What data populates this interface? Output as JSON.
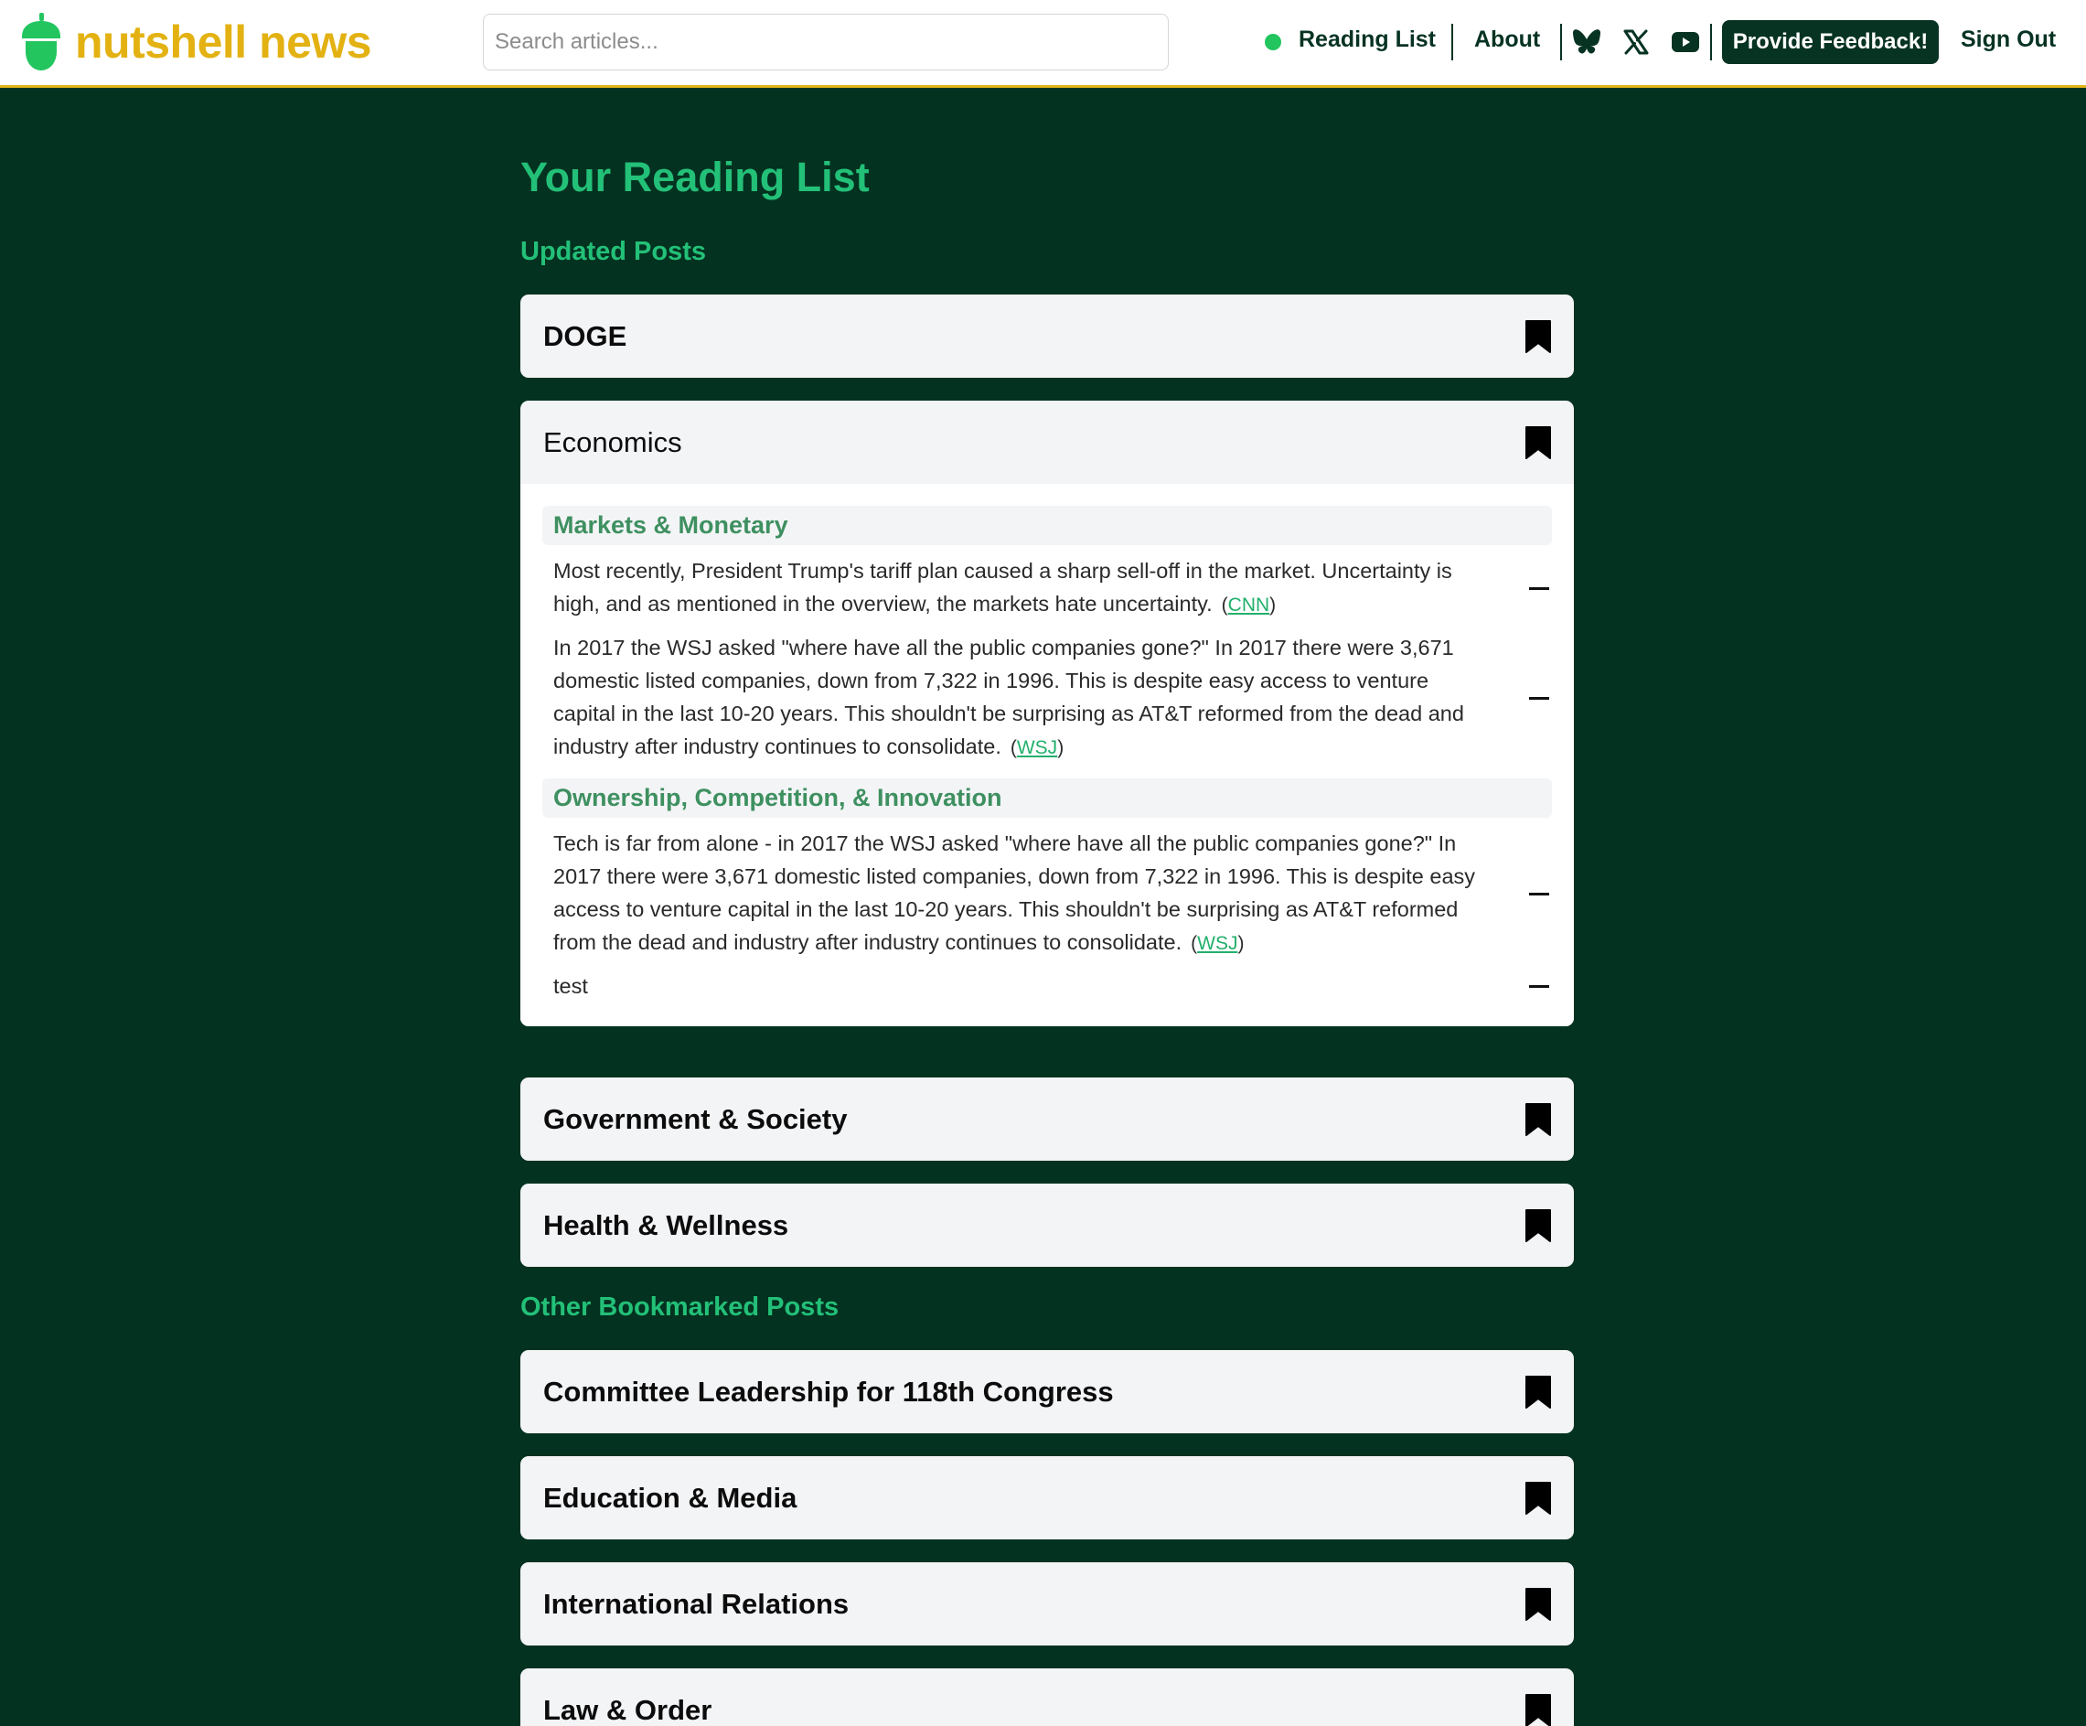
{
  "header": {
    "brand": "nutshell news",
    "search_placeholder": "Search articles...",
    "nav": {
      "reading_list": "Reading List",
      "about": "About",
      "feedback": "Provide Feedback!",
      "sign_out": "Sign Out"
    },
    "social_icons": [
      "bluesky-icon",
      "x-icon",
      "youtube-icon"
    ],
    "status_color": "#22c55e"
  },
  "page": {
    "title": "Your Reading List",
    "updated_heading": "Updated Posts",
    "other_heading": "Other Bookmarked Posts"
  },
  "updated_posts": [
    {
      "title": "DOGE"
    },
    {
      "title": "Economics",
      "sections": [
        {
          "heading": "Markets & Monetary",
          "items": [
            {
              "text": "Most recently, President Trump's tariff plan caused a sharp sell-off in the market. Uncertainty is high, and as mentioned in the overview, the markets hate uncertainty.",
              "source": "CNN"
            },
            {
              "text": "In 2017 the WSJ asked \"where have all the public companies gone?\" In 2017 there were 3,671 domestic listed companies, down from 7,322 in 1996. This is despite easy access to venture capital in the last 10-20 years. This shouldn't be surprising as AT&T reformed from the dead and industry after industry continues to consolidate.",
              "source": "WSJ"
            }
          ]
        },
        {
          "heading": "Ownership, Competition, & Innovation",
          "items": [
            {
              "text": "Tech is far from alone - in 2017 the WSJ asked \"where have all the public companies gone?\" In 2017 there were 3,671 domestic listed companies, down from 7,322 in 1996. This is despite easy access to venture capital in the last 10-20 years. This shouldn't be surprising as AT&T reformed from the dead and industry after industry continues to consolidate.",
              "source": "WSJ"
            },
            {
              "text": "test"
            }
          ]
        }
      ]
    },
    {
      "title": "Government & Society"
    },
    {
      "title": "Health & Wellness"
    }
  ],
  "other_posts": [
    {
      "title": "Committee Leadership for 118th Congress"
    },
    {
      "title": "Education & Media"
    },
    {
      "title": "International Relations"
    },
    {
      "title": "Law & Order"
    }
  ]
}
